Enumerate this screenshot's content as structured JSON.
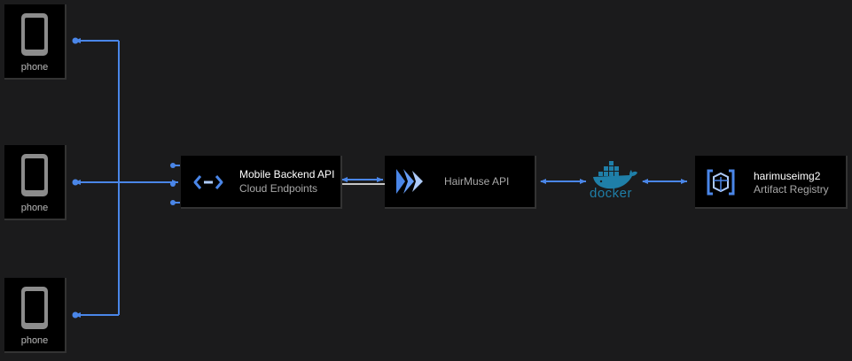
{
  "nodes": {
    "phone_label": "phone",
    "backend": {
      "title": "Mobile Backend API",
      "subtitle": "Cloud Endpoints"
    },
    "hairmuse": {
      "title": "HairMuse API"
    },
    "docker": {
      "label": "docker"
    },
    "registry": {
      "title": "harimuseimg2",
      "subtitle": "Artifact Registry"
    }
  },
  "colors": {
    "background": "#1b1b1c",
    "connector": "#4a86e8",
    "node_fill": "#000000",
    "docker_blue": "#1f7fa8",
    "phone_gray": "#8c8c8c"
  },
  "icons": {
    "phone": "phone-icon",
    "backend": "cloud-endpoints-icon",
    "hairmuse": "api-gateway-icon",
    "docker": "docker-whale-icon",
    "registry": "artifact-registry-icon"
  }
}
